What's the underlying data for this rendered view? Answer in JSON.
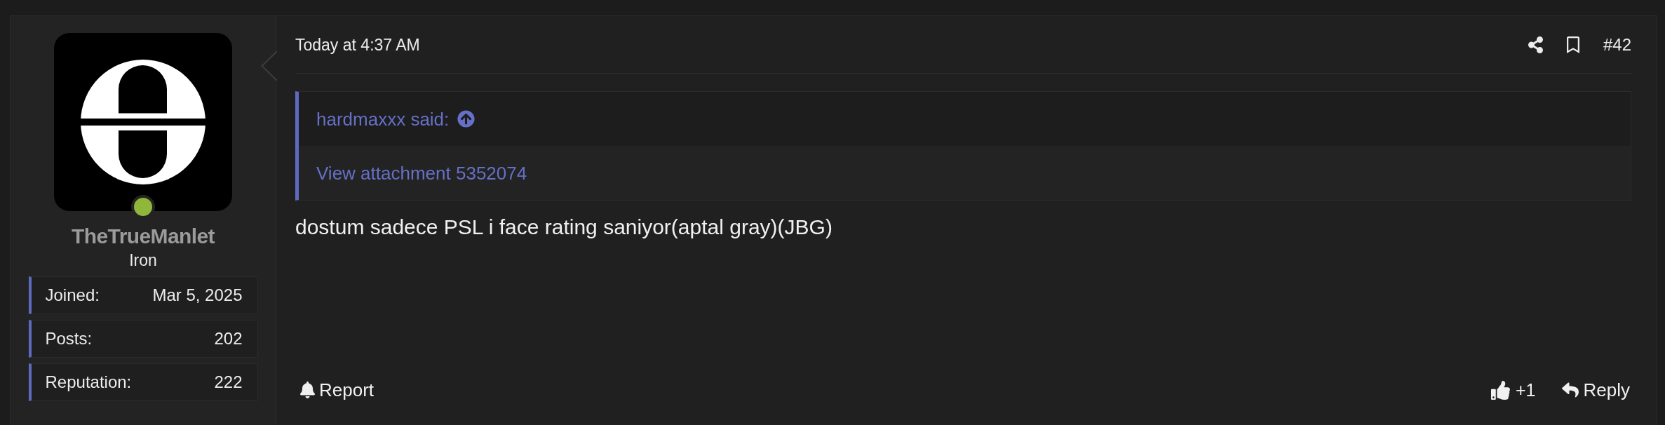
{
  "post": {
    "author": {
      "name": "TheTrueManlet",
      "online": true,
      "title": "Iron",
      "stats": [
        {
          "label": "Joined:",
          "value": "Mar 5, 2025"
        },
        {
          "label": "Posts:",
          "value": "202"
        },
        {
          "label": "Reputation:",
          "value": "222"
        }
      ]
    },
    "header": {
      "timestamp": "Today at 4:37 AM",
      "number": "#42"
    },
    "quote": {
      "attribution": "hardmaxxx said:",
      "content": "View attachment 5352074"
    },
    "body": "dostum sadece PSL i face rating saniyor(aptal gray)(JBG)",
    "actions": {
      "report": "Report",
      "reaction_count": "+1",
      "reply": "Reply"
    }
  }
}
